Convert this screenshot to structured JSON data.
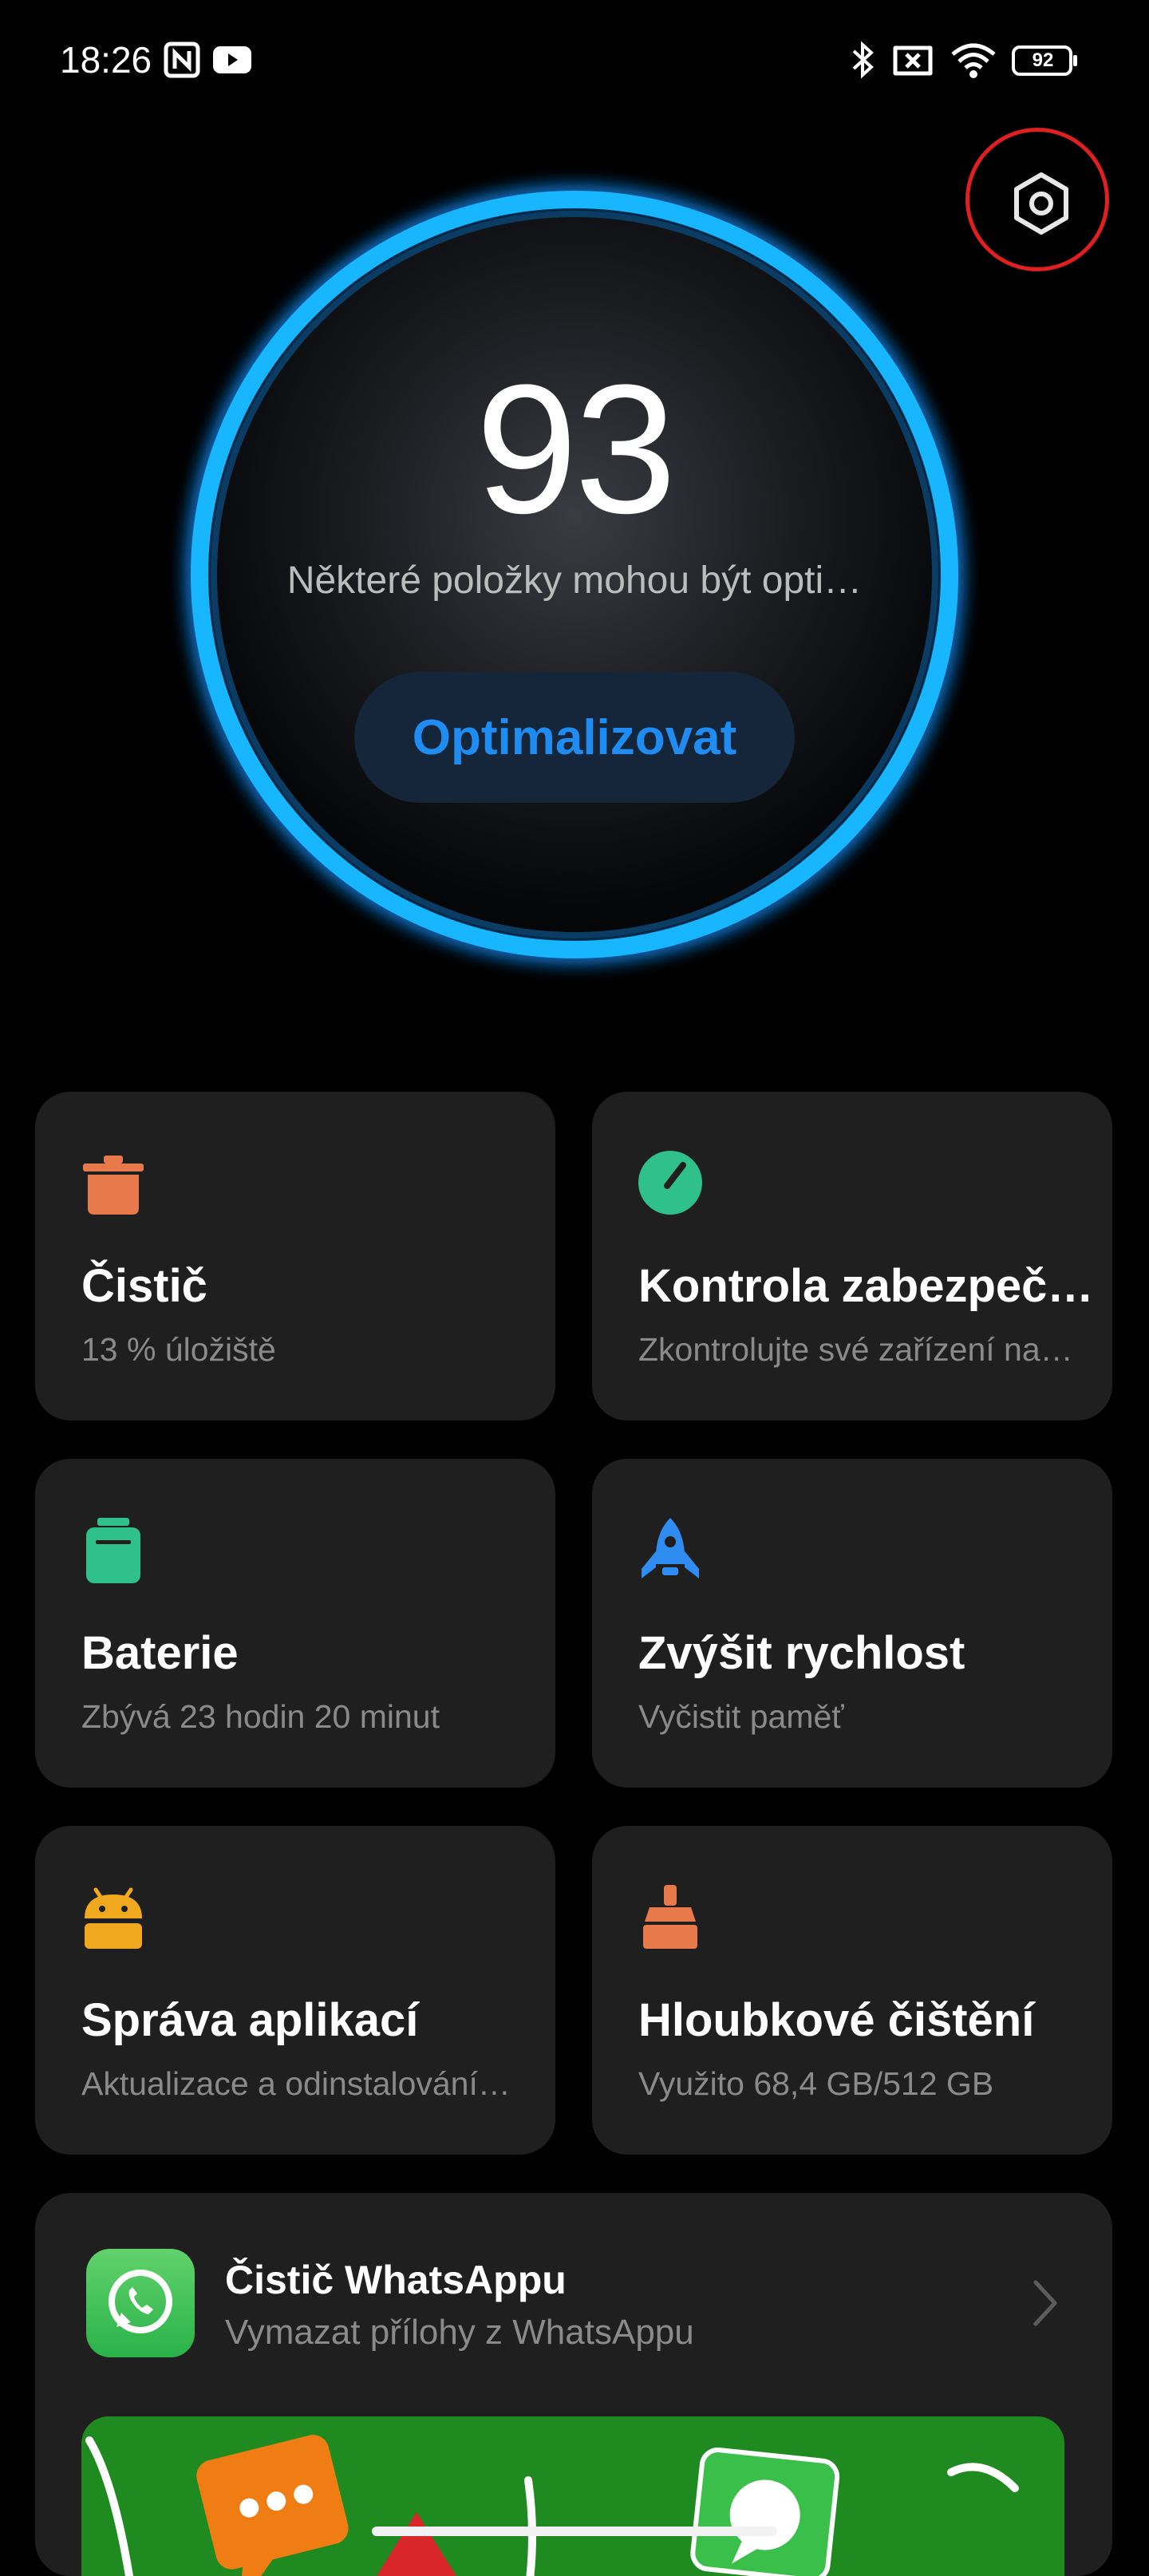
{
  "status_bar": {
    "time": "18:26",
    "battery": "92",
    "icons": [
      "nfc-icon",
      "youtube-icon",
      "bluetooth-icon",
      "no-sim-icon",
      "wifi-icon",
      "battery-icon"
    ]
  },
  "settings": {
    "icon": "gear-icon"
  },
  "score": {
    "value": "93",
    "subtitle": "Některé položky mohou být opti…",
    "button_label": "Optimalizovat",
    "ring_color": "#16b4ff",
    "button_color": "#1e8cf0"
  },
  "cards": [
    {
      "title": "Čistič",
      "subtitle": "13 % úložiště",
      "icon": "trash-icon",
      "color": "#e8794a"
    },
    {
      "title": "Kontrola zabezpeč…",
      "subtitle": "Zkontrolujte své zařízení na…",
      "icon": "security-icon",
      "color": "#2fc08b"
    },
    {
      "title": "Baterie",
      "subtitle": "Zbývá 23 hodin 20 minut",
      "icon": "battery-icon",
      "color": "#2fc08b"
    },
    {
      "title": "Zvýšit rychlost",
      "subtitle": "Vyčistit paměť",
      "icon": "rocket-icon",
      "color": "#2f8cf0"
    },
    {
      "title": "Správa aplikací",
      "subtitle": "Aktualizace a odinstalování…",
      "icon": "android-icon",
      "color": "#f0a81e"
    },
    {
      "title": "Hloubkové čištění",
      "subtitle": "Využito 68,4 GB/512 GB",
      "icon": "brush-icon",
      "color": "#e8794a"
    }
  ],
  "whatsapp": {
    "title": "Čistič WhatsAppu",
    "subtitle": "Vymazat přílohy z WhatsAppu",
    "icon": "whatsapp-icon",
    "banner_color": "#1f8a1f"
  }
}
